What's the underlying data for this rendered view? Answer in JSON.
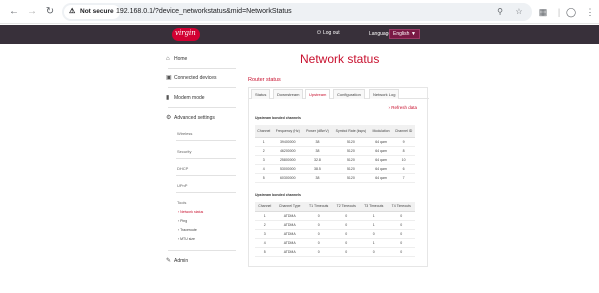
{
  "browser": {
    "security_label": "Not secure",
    "url": "192.168.0.1/?device_networkstatus&mid=NetworkStatus",
    "icons": [
      "back-icon",
      "forward-icon",
      "reload-icon",
      "security-warning-icon",
      "search-icon",
      "star-icon",
      "extensions-icon",
      "profile-icon",
      "menu-icon"
    ]
  },
  "header": {
    "logout_label": "Log out",
    "language_label": "Language:",
    "language_value": "English",
    "brand_color": "#c8102e",
    "bar_color": "#38303a"
  },
  "page_title": "Network status",
  "sidebar": {
    "items": [
      {
        "label": "Home",
        "icon": "home-icon"
      },
      {
        "label": "Connected devices",
        "icon": "devices-icon"
      },
      {
        "label": "Modem mode",
        "icon": "modem-icon"
      },
      {
        "label": "Advanced settings",
        "icon": "gear-icon"
      },
      {
        "label": "Admin",
        "icon": "admin-icon"
      }
    ],
    "advanced_sub": [
      "Wireless",
      "Security",
      "DHCP",
      "UPnP",
      "Tools"
    ],
    "tools": [
      "Network status",
      "Ping",
      "Traceroute",
      "MTU size"
    ]
  },
  "main": {
    "section_title": "Router status",
    "tabs": [
      "Status",
      "Downstream",
      "Upstream",
      "Configuration",
      "Network Log"
    ],
    "active_tab": "Upstream",
    "refresh_label": "Refresh data",
    "table1": {
      "title": "Upstream bonded channels",
      "headers": [
        "Channel",
        "Frequency (Hz)",
        "Power (dBmV)",
        "Symbol Rate (ksps)",
        "Modulation",
        "Channel ID"
      ],
      "rows": [
        [
          "1",
          "39400000",
          "38",
          "5120",
          "64 qam",
          "9"
        ],
        [
          "2",
          "46200000",
          "38",
          "5120",
          "64 qam",
          "8"
        ],
        [
          "3",
          "25800000",
          "32.8",
          "5120",
          "64 qam",
          "10"
        ],
        [
          "4",
          "53000000",
          "38.5",
          "5120",
          "64 qam",
          "6"
        ],
        [
          "5",
          "60300000",
          "38",
          "5120",
          "64 qam",
          "7"
        ]
      ]
    },
    "table2": {
      "title": "Upstream bonded channels",
      "headers": [
        "Channel",
        "Channel Type",
        "T1 Timeouts",
        "T2 Timeouts",
        "T3 Timeouts",
        "T4 Timeouts"
      ],
      "rows": [
        [
          "1",
          "ATDMA",
          "0",
          "0",
          "1",
          "0"
        ],
        [
          "2",
          "ATDMA",
          "0",
          "0",
          "1",
          "0"
        ],
        [
          "3",
          "ATDMA",
          "0",
          "0",
          "0",
          "0"
        ],
        [
          "4",
          "ATDMA",
          "0",
          "0",
          "1",
          "0"
        ],
        [
          "5",
          "ATDMA",
          "0",
          "0",
          "0",
          "0"
        ]
      ]
    }
  }
}
